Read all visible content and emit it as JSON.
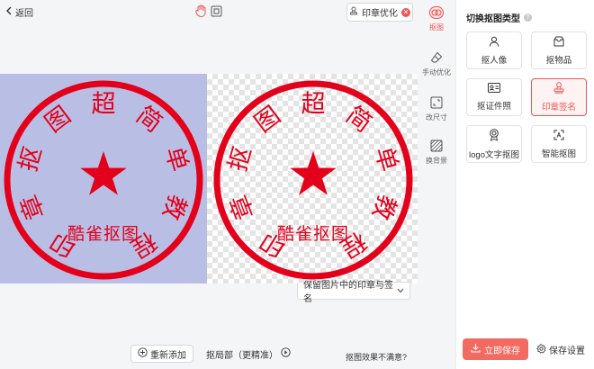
{
  "header": {
    "back_label": "返回",
    "optimize_label": "印章优化",
    "optimize_badge": "✕"
  },
  "canvas": {
    "seal": {
      "arc_chars": [
        "印",
        "章",
        "抠",
        "图",
        "超",
        "简",
        "单",
        "教",
        "程"
      ],
      "bottom_text": "酷雀抠图",
      "color": "#e3001b"
    },
    "original_bg": "#b9bfe4",
    "keep_option": "保留图片中的印章与签名"
  },
  "bottom": {
    "re_add_label": "重新添加",
    "partial_label": "抠局部（更精准）",
    "feedback_label": "抠图效果不满意?"
  },
  "side_tools": [
    {
      "label": "抠图",
      "icon": "cutout-icon",
      "active": true
    },
    {
      "label": "手动优化",
      "icon": "eraser-icon",
      "active": false
    },
    {
      "label": "改尺寸",
      "icon": "resize-icon",
      "active": false
    },
    {
      "label": "换背景",
      "icon": "background-icon",
      "active": false
    }
  ],
  "panel": {
    "title": "切换抠图类型",
    "types": [
      {
        "label": "抠人像",
        "icon": "person-icon",
        "active": false
      },
      {
        "label": "抠物品",
        "icon": "box-icon",
        "active": false
      },
      {
        "label": "抠证件照",
        "icon": "id-card-icon",
        "active": false
      },
      {
        "label": "印章签名",
        "icon": "stamp-icon",
        "active": true
      },
      {
        "label": "logo文字抠图",
        "icon": "badge-icon",
        "active": false
      },
      {
        "label": "智能抠图",
        "icon": "smart-scan-icon",
        "active": false
      }
    ],
    "save_label": "立即保存",
    "settings_label": "保存设置"
  },
  "colors": {
    "accent": "#f05353",
    "save": "#f26b60"
  }
}
